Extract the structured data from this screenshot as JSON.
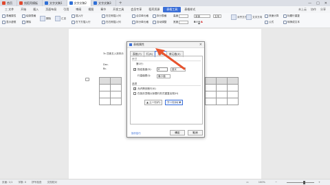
{
  "tabs": [
    {
      "label": "首页",
      "color": "#e0492f"
    },
    {
      "label": "找稻壳模板",
      "color": "#e0492f"
    },
    {
      "label": "文字文稿1",
      "color": "#2f6fd6"
    },
    {
      "label": "文字文稿2",
      "color": "#2f6fd6",
      "active": true
    },
    {
      "label": "文字文稿3",
      "color": "#2f6fd6"
    }
  ],
  "menus": [
    "三 文件",
    "开始",
    "插入",
    "页面布局",
    "引用",
    "审阅",
    "视图",
    "章节",
    "开发工具",
    "会员专享",
    "稻壳资源",
    "表格工具",
    "表格样式"
  ],
  "active_menu": "表格工具",
  "menu_right": [
    "未上云",
    "协作",
    "分享"
  ],
  "toolbar": {
    "items": [
      "表格属性",
      "显示虚框",
      "绘制表格",
      "擦除",
      "删除",
      "汇总",
      "插入行",
      "在下方插入行",
      "在左侧插入列",
      "在右侧插入列",
      "合并单元格",
      "拆分单元格",
      "拆分表格",
      "自动调整",
      "高度",
      "宽度",
      "宋体",
      "五号",
      "对齐方式",
      "文字方向",
      "快速计算",
      "标题行重复",
      "转换成文本",
      "公式"
    ]
  },
  "document": {
    "line1": "3c 四舍五入到本示",
    "line2": "Dec.",
    "line3": "Bc."
  },
  "dialog": {
    "title": "表格属性",
    "tabs": [
      "表格(T)",
      "行(R)",
      "列(U)",
      "单元格(E)"
    ],
    "active_tab": "列(U)",
    "section_size": "尺寸",
    "row_label": "第1行:",
    "specify_height": "指定高度(S):",
    "height_value": "0",
    "unit": "厘米",
    "row_height_label": "行高值是(I):",
    "row_height_value": "最小值",
    "section_options": "选项",
    "opt1": "允许跨页断行(K)",
    "opt2": "在各页顶端以标题行形式重复出现(H)",
    "prev_button": "▲ 上一行(P)",
    "next_button": "下一行(N) ▼",
    "tip": "操作技巧",
    "ok": "确定",
    "cancel": "取消"
  },
  "status": {
    "page": "页面: 1/1",
    "words": "字数: 0",
    "spell": "拼写检查",
    "doc_check": "文档校对",
    "zoom": "100%"
  }
}
